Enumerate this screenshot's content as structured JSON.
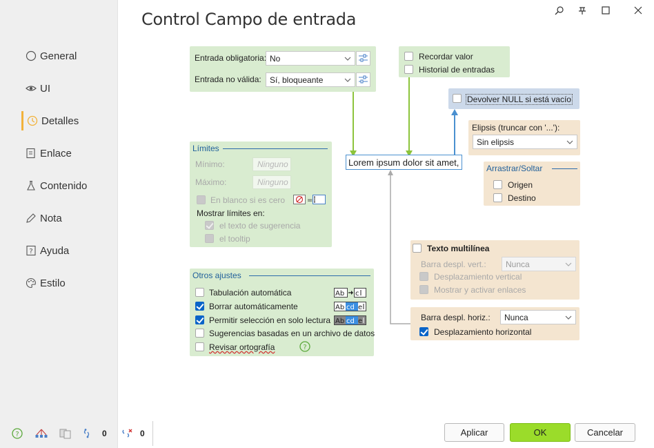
{
  "window": {
    "title": "Control Campo de entrada",
    "icons": [
      "search-icon",
      "pin-icon",
      "maximize-icon",
      "close-icon"
    ]
  },
  "sidebar": {
    "items": [
      {
        "label": "General",
        "icon": "circle-icon"
      },
      {
        "label": "UI",
        "icon": "eye-icon"
      },
      {
        "label": "Detalles",
        "icon": "clock-icon",
        "active": true
      },
      {
        "label": "Enlace",
        "icon": "link-icon"
      },
      {
        "label": "Contenido",
        "icon": "flask-icon"
      },
      {
        "label": "Nota",
        "icon": "pencil-icon"
      },
      {
        "label": "Ayuda",
        "icon": "help-doc-icon"
      },
      {
        "label": "Estilo",
        "icon": "palette-icon"
      }
    ],
    "active_color": "#f2b23a",
    "bottom": {
      "count_1": "0",
      "count_2": "0"
    }
  },
  "validation": {
    "required_label": "Entrada obligatoria:",
    "required_value": "No",
    "invalid_label": "Entrada no válida:",
    "invalid_value": "Sí, bloqueante"
  },
  "remember": {
    "remember_value": "Recordar valor",
    "history": "Historial de entradas"
  },
  "null_box": {
    "label": "Devolver NULL si está vacío"
  },
  "ellipsis": {
    "label": "Elipsis (truncar con '...'):",
    "value": "Sin elipsis"
  },
  "drag": {
    "title": "Arrastrar/Soltar",
    "origin": "Origen",
    "destination": "Destino"
  },
  "limits": {
    "title": "Límites",
    "min_label": "Mínimo:",
    "min_placeholder": "Ninguno",
    "max_label": "Máximo:",
    "max_placeholder": "Ninguno",
    "blank_zero": "En blanco si es cero",
    "show_limits": "Mostrar límites en:",
    "hint_text": "el texto de sugerencia",
    "tooltip": "el tooltip"
  },
  "preview": {
    "text": "Lorem ipsum dolor sit amet,"
  },
  "other": {
    "title": "Otros ajustes",
    "auto_tab": "Tabulación automática",
    "auto_clear": "Borrar automáticamente",
    "readonly_select": "Permitir selección en solo lectura",
    "suggestions": "Sugerencias basadas en un archivo de datos",
    "spell_check": "Revisar ortografía",
    "auto_tab_checked": false,
    "auto_clear_checked": true,
    "readonly_select_checked": true,
    "suggestions_checked": false,
    "spell_check_checked": false,
    "sample_ab": "Ab",
    "sample_cd": "cd",
    "sample_ef": "ef"
  },
  "multiline": {
    "title": "Texto multilínea",
    "vscroll_label": "Barra despl. vert.:",
    "vscroll_value": "Nunca",
    "vertical_scroll": "Desplazamiento vertical",
    "show_links": "Mostrar y activar enlaces"
  },
  "hscroll": {
    "label": "Barra despl. horiz.:",
    "value": "Nunca",
    "horizontal_scroll": "Desplazamiento horizontal",
    "horizontal_scroll_checked": true
  },
  "buttons": {
    "apply": "Aplicar",
    "ok": "OK",
    "cancel": "Cancelar"
  },
  "colors": {
    "green_panel": "#d9ecd0",
    "peach_panel": "#f4e5d0",
    "blue_panel": "#ccd9ea",
    "ok_button": "#9bdc2a",
    "arrow_green": "#8cc43c",
    "arrow_blue": "#4a90d0",
    "arrow_gray": "#aaaaaa"
  }
}
